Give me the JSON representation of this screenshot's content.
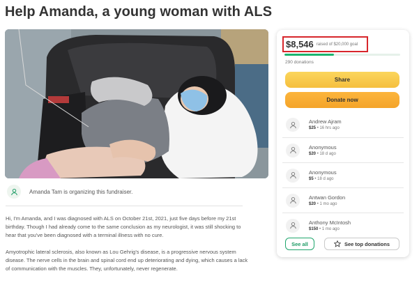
{
  "page": {
    "title": "Help Amanda, a young woman with ALS"
  },
  "organizer": {
    "text": "Amanda Tam is organizing this fundraiser.",
    "icon": "person-icon"
  },
  "story": {
    "paragraph1": "Hi, I'm Amanda, and I was diagnosed with ALS on October 21st, 2021, just five days before my 21st birthday. Though I had already come to the same conclusion as my neurologist, it was still shocking to hear that you've been diagnosed with a terminal illness with no cure.",
    "paragraph2": "Amyotrophic lateral sclerosis, also known as Lou Gehrig's disease, is a progressive nervous system disease. The nerve cells in the brain and spinal cord end up deteriorating and dying, which causes a lack of communication with the muscles. They, unfortunately, never regenerate."
  },
  "donation_card": {
    "raised_amount": "$8,546",
    "goal_text": "raised of $20,000 goal",
    "progress_fraction": 0.43,
    "donation_count": "290 donations",
    "share_label": "Share",
    "donate_label": "Donate now",
    "donors": [
      {
        "name": "Andrew Ajram",
        "amount": "$25",
        "time": "16 hrs ago"
      },
      {
        "name": "Anonymous",
        "amount": "$20",
        "time": "18 d ago"
      },
      {
        "name": "Anonymous",
        "amount": "$5",
        "time": "18 d ago"
      },
      {
        "name": "Antwan Gordon",
        "amount": "$20",
        "time": "1 mo ago"
      },
      {
        "name": "Anthony McIntosh",
        "amount": "$150",
        "time": "1 mo ago"
      }
    ],
    "see_all_label": "See all",
    "top_donations_label": "See top donations",
    "separator": "•"
  },
  "colors": {
    "accent_green": "#1bb46e",
    "share_yellow": "#f5bf3e",
    "donate_orange": "#f4a42a",
    "highlight_red": "#d7262b"
  }
}
